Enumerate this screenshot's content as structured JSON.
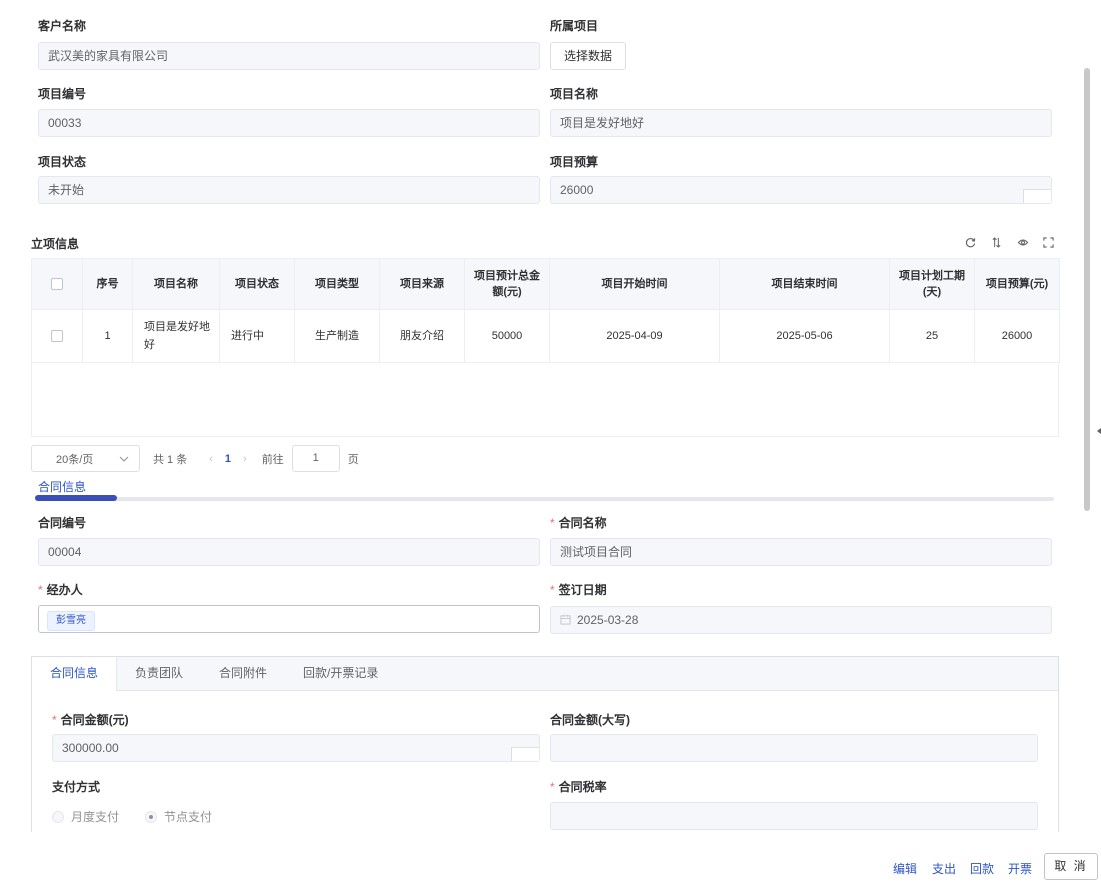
{
  "form": {
    "customer_name_label": "客户名称",
    "customer_name_value": "武汉美的家具有限公司",
    "project_label": "所属项目",
    "select_data_button": "选择数据",
    "project_code_label": "项目编号",
    "project_code_value": "00033",
    "project_name_label": "项目名称",
    "project_name_value": "项目是发好地好",
    "project_status_label": "项目状态",
    "project_status_value": "未开始",
    "project_budget_label": "项目预算",
    "project_budget_value": "26000"
  },
  "project_info": {
    "title": "立项信息",
    "columns": [
      "序号",
      "项目名称",
      "项目状态",
      "项目类型",
      "项目来源",
      "项目预计总金额(元)",
      "项目开始时间",
      "项目结束时间",
      "项目计划工期(天)",
      "项目预算(元)"
    ],
    "rows": [
      {
        "index": "1",
        "name": "项目是发好地好",
        "status": "进行中",
        "type": "生产制造",
        "source": "朋友介绍",
        "total": "50000",
        "start": "2025-04-09",
        "end": "2025-05-06",
        "duration": "25",
        "budget": "26000"
      }
    ]
  },
  "pager": {
    "page_size": "20条/页",
    "total": "共 1 条",
    "current_page": "1",
    "goto_label": "前往",
    "goto_value": "1",
    "page_unit": "页"
  },
  "contract": {
    "segment_tab": "合同信息",
    "code_label": "合同编号",
    "code_value": "00004",
    "name_label": "合同名称",
    "name_value": "测试项目合同",
    "handler_label": "经办人",
    "handler_tag": "彭雪亮",
    "sign_date_label": "签订日期",
    "sign_date_value": "2025-03-28"
  },
  "detail_tabs": [
    "合同信息",
    "负责团队",
    "合同附件",
    "回款/开票记录"
  ],
  "detail": {
    "amount_label": "合同金额(元)",
    "amount_value": "300000.00",
    "amount_upper_label": "合同金额(大写)",
    "amount_upper_value": "",
    "pay_method_label": "支付方式",
    "pay_options": [
      "月度支付",
      "节点支付"
    ],
    "tax_rate_label": "合同税率",
    "tax_rate_value": ""
  },
  "footer": {
    "edit": "编辑",
    "expense": "支出",
    "refund": "回款",
    "invoice": "开票",
    "cancel": "取 消"
  }
}
